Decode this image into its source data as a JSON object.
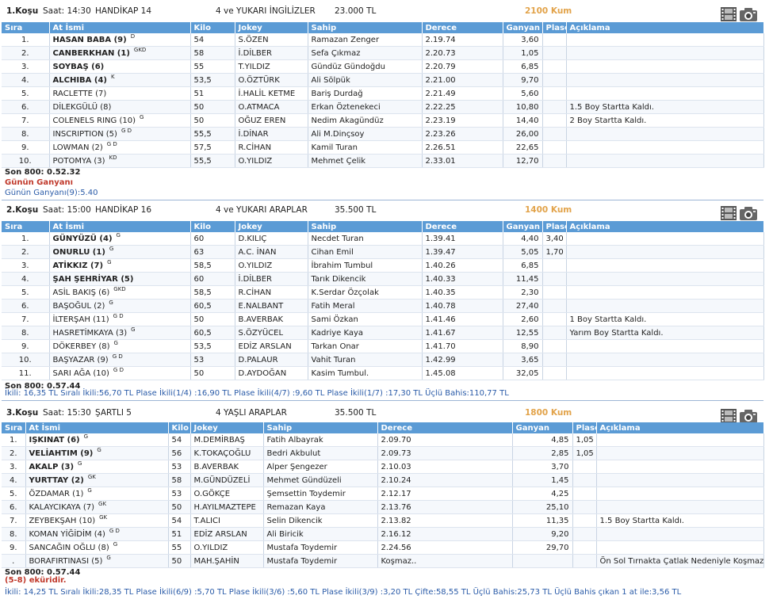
{
  "labels": {
    "son800_label": "Son 800:",
    "cols1": [
      "Sıra",
      "At İsmi",
      "Kilo",
      "Jokey",
      "Sahip",
      "Derece",
      "Ganyan",
      "Plase",
      "Açıklama"
    ],
    "cols3": [
      "Sıra",
      "At İsmi",
      "Kilo",
      "Jokey",
      "Sahip",
      "Derece",
      "Ganyan",
      "Plase",
      "Açıklama"
    ]
  },
  "races": [
    {
      "title": "1.Koşu",
      "time": "Saat: 14:30",
      "type": "HANDİKAP  14",
      "group": "4 ve YUKARI İNGİLİZLER",
      "prize": "23.000 TL",
      "distance": "2100 Kum",
      "son800": "Son 800: 0.52.32",
      "red_note": "Günün Ganyanı",
      "info": "Günün Ganyanı(9):5.40",
      "rows": [
        {
          "no": "1.",
          "name": "HASAN BABA (9)",
          "sup": "D",
          "bold": true,
          "kilo": "54",
          "jokey": "S.ÖZEN",
          "sahip": "Ramazan Zenger",
          "derece": "2.19.74",
          "ganyan": "3,60",
          "plase": "",
          "aciklama": ""
        },
        {
          "no": "2.",
          "name": "CANBERKHAN (1)",
          "sup": "GKD",
          "bold": true,
          "kilo": "58",
          "jokey": "İ.DİLBER",
          "sahip": "Sefa Çıkmaz",
          "derece": "2.20.73",
          "ganyan": "1,05",
          "plase": "",
          "aciklama": ""
        },
        {
          "no": "3.",
          "name": "SOYBAŞ (6)",
          "sup": "",
          "bold": true,
          "kilo": "55",
          "jokey": "T.YILDIZ",
          "sahip": "Gündüz Gündoğdu",
          "derece": "2.20.79",
          "ganyan": "6,85",
          "plase": "",
          "aciklama": ""
        },
        {
          "no": "4.",
          "name": "ALCHIBA (4)",
          "sup": "K",
          "bold": true,
          "kilo": "53,5",
          "jokey": "O.ÖZTÜRK",
          "sahip": "Ali Sölpük",
          "derece": "2.21.00",
          "ganyan": "9,70",
          "plase": "",
          "aciklama": ""
        },
        {
          "no": "5.",
          "name": "RACLETTE (7)",
          "sup": "",
          "bold": false,
          "kilo": "51",
          "jokey": "İ.HALİL KETME",
          "sahip": "Bariş Durdağ",
          "derece": "2.21.49",
          "ganyan": "5,60",
          "plase": "",
          "aciklama": ""
        },
        {
          "no": "6.",
          "name": "DİLEKGÜLÜ (8)",
          "sup": "",
          "bold": false,
          "kilo": "50",
          "jokey": "O.ATMACA",
          "sahip": "Erkan Öztenekeci",
          "derece": "2.22.25",
          "ganyan": "10,80",
          "plase": "",
          "aciklama": "1.5 Boy Startta Kaldı."
        },
        {
          "no": "7.",
          "name": "COLENELS RING (10)",
          "sup": "G",
          "bold": false,
          "kilo": "50",
          "jokey": "OĞUZ EREN",
          "sahip": "Nedim Akagündüz",
          "derece": "2.23.19",
          "ganyan": "14,40",
          "plase": "",
          "aciklama": "2 Boy Startta Kaldı."
        },
        {
          "no": "8.",
          "name": "INSCRIPTION (5)",
          "sup": "G D",
          "bold": false,
          "kilo": "55,5",
          "jokey": "İ.DİNAR",
          "sahip": "Ali M.Dinçsoy",
          "derece": "2.23.26",
          "ganyan": "26,00",
          "plase": "",
          "aciklama": ""
        },
        {
          "no": "9.",
          "name": "LOWMAN (2)",
          "sup": "G D",
          "bold": false,
          "kilo": "57,5",
          "jokey": "R.CİHAN",
          "sahip": "Kamil Turan",
          "derece": "2.26.51",
          "ganyan": "22,65",
          "plase": "",
          "aciklama": ""
        },
        {
          "no": "10.",
          "name": "POTOMYA (3)",
          "sup": "KD",
          "bold": false,
          "kilo": "55,5",
          "jokey": "O.YILDIZ",
          "sahip": "Mehmet Çelik",
          "derece": "2.33.01",
          "ganyan": "12,70",
          "plase": "",
          "aciklama": ""
        }
      ]
    },
    {
      "title": "2.Koşu",
      "time": "Saat: 15:00",
      "type": "HANDİKAP  16",
      "group": "4 ve YUKARI ARAPLAR",
      "prize": "35.500 TL",
      "distance": "1400 Kum",
      "son800": "Son 800: 0.57.44",
      "red_note": "",
      "info": "İkili: 16,35 TL Sıralı İkili:56,70 TL Plase İkili(1/4) :16,90 TL Plase İkili(4/7) :9,60 TL Plase İkili(1/7) :17,30 TL Üçlü Bahis:110,77 TL",
      "rows": [
        {
          "no": "1.",
          "name": "GÜNYÜZÜ (4)",
          "sup": "G",
          "bold": true,
          "kilo": "60",
          "jokey": "D.KILIÇ",
          "sahip": "Necdet Turan",
          "derece": "1.39.41",
          "ganyan": "4,40",
          "plase": "3,40",
          "aciklama": ""
        },
        {
          "no": "2.",
          "name": "ONURLU (1)",
          "sup": "G",
          "bold": true,
          "kilo": "63",
          "jokey": "A.C. İNAN",
          "sahip": "Cihan Emil",
          "derece": "1.39.47",
          "ganyan": "5,05",
          "plase": "1,70",
          "aciklama": ""
        },
        {
          "no": "3.",
          "name": "ATİKKIZ (7)",
          "sup": "G",
          "bold": true,
          "kilo": "58,5",
          "jokey": "O.YILDIZ",
          "sahip": "İbrahim Tumbul",
          "derece": "1.40.26",
          "ganyan": "6,85",
          "plase": "",
          "aciklama": ""
        },
        {
          "no": "4.",
          "name": "ŞAH ŞEHRİYAR (5)",
          "sup": "",
          "bold": true,
          "kilo": "60",
          "jokey": "İ.DİLBER",
          "sahip": "Tarık Dikencik",
          "derece": "1.40.33",
          "ganyan": "11,45",
          "plase": "",
          "aciklama": ""
        },
        {
          "no": "5.",
          "name": "ASİL BAKIŞ (6)",
          "sup": "GKD",
          "bold": false,
          "kilo": "58,5",
          "jokey": "R.CİHAN",
          "sahip": "K.Serdar Özçolak",
          "derece": "1.40.35",
          "ganyan": "2,30",
          "plase": "",
          "aciklama": ""
        },
        {
          "no": "6.",
          "name": "BAŞOĞUL (2)",
          "sup": "G",
          "bold": false,
          "kilo": "60,5",
          "jokey": "E.NALBANT",
          "sahip": "Fatih Meral",
          "derece": "1.40.78",
          "ganyan": "27,40",
          "plase": "",
          "aciklama": ""
        },
        {
          "no": "7.",
          "name": "İLTERŞAH (11)",
          "sup": "G D",
          "bold": false,
          "kilo": "50",
          "jokey": "B.AVERBAK",
          "sahip": "Sami Özkan",
          "derece": "1.41.46",
          "ganyan": "2,60",
          "plase": "",
          "aciklama": "1 Boy Startta Kaldı."
        },
        {
          "no": "8.",
          "name": "HASRETİMKAYA (3)",
          "sup": "G",
          "bold": false,
          "kilo": "60,5",
          "jokey": "S.ÖZYÜCEL",
          "sahip": "Kadriye Kaya",
          "derece": "1.41.67",
          "ganyan": "12,55",
          "plase": "",
          "aciklama": "Yarım Boy Startta Kaldı."
        },
        {
          "no": "9.",
          "name": "DÖKERBEY (8)",
          "sup": "G",
          "bold": false,
          "kilo": "53,5",
          "jokey": "EDİZ ARSLAN",
          "sahip": "Tarkan Onar",
          "derece": "1.41.70",
          "ganyan": "8,90",
          "plase": "",
          "aciklama": ""
        },
        {
          "no": "10.",
          "name": "BAŞYAZAR (9)",
          "sup": "G D",
          "bold": false,
          "kilo": "53",
          "jokey": "D.PALAUR",
          "sahip": "Vahit Turan",
          "derece": "1.42.99",
          "ganyan": "3,65",
          "plase": "",
          "aciklama": ""
        },
        {
          "no": "11.",
          "name": "SARI AĞA (10)",
          "sup": "G D",
          "bold": false,
          "kilo": "50",
          "jokey": "D.AYDOĞAN",
          "sahip": "Kasim Tumbul.",
          "derece": "1.45.08",
          "ganyan": "32,05",
          "plase": "",
          "aciklama": ""
        }
      ]
    },
    {
      "title": "3.Koşu",
      "time": "Saat: 15:30",
      "type": "ŞARTLI  5",
      "group": "4 YAŞLI ARAPLAR",
      "prize": "35.500 TL",
      "distance": "1800 Kum",
      "son800": "Son 800: 0.57.44",
      "red_note": "(5-8) eküridir.",
      "info": "İkili: 14,25 TL Sıralı İkili:28,35 TL Plase İkili(6/9) :5,70 TL Plase İkili(3/6) :5,60 TL Plase İkili(3/9) :3,20 TL Çifte:58,55 TL Üçlü Bahis:25,73 TL Üçlü Bahis çıkan 1 at ile:3,56 TL",
      "rows": [
        {
          "no": "1.",
          "name": "IŞKINAT (6)",
          "sup": "G",
          "bold": true,
          "kilo": "54",
          "jokey": "M.DEMİRBAŞ",
          "sahip": "Fatih Albayrak",
          "derece": "2.09.70",
          "ganyan": "4,85",
          "plase": "1,05",
          "aciklama": ""
        },
        {
          "no": "2.",
          "name": "VELİAHTIM (9)",
          "sup": "G",
          "bold": true,
          "kilo": "56",
          "jokey": "K.TOKAÇOĞLU",
          "sahip": "Bedri Akbulut",
          "derece": "2.09.73",
          "ganyan": "2,85",
          "plase": "1,05",
          "aciklama": ""
        },
        {
          "no": "3.",
          "name": "AKALP (3)",
          "sup": "G",
          "bold": true,
          "kilo": "53",
          "jokey": "B.AVERBAK",
          "sahip": "Alper Şengezer",
          "derece": "2.10.03",
          "ganyan": "3,70",
          "plase": "",
          "aciklama": ""
        },
        {
          "no": "4.",
          "name": "YURTTAY (2)",
          "sup": "GK",
          "bold": true,
          "kilo": "58",
          "jokey": "M.GÜNDÜZELİ",
          "sahip": "Mehmet Gündüzeli",
          "derece": "2.10.24",
          "ganyan": "1,45",
          "plase": "",
          "aciklama": ""
        },
        {
          "no": "5.",
          "name": "ÖZDAMAR (1)",
          "sup": "G",
          "bold": false,
          "kilo": "53",
          "jokey": "O.GÖKÇE",
          "sahip": "Şemsettin Toydemir",
          "derece": "2.12.17",
          "ganyan": "4,25",
          "plase": "",
          "aciklama": ""
        },
        {
          "no": "6.",
          "name": "KALAYCIKAYA (7)",
          "sup": "GK",
          "bold": false,
          "kilo": "50",
          "jokey": "H.AYILMAZTEPE",
          "sahip": "Remazan Kaya",
          "derece": "2.13.76",
          "ganyan": "25,10",
          "plase": "",
          "aciklama": ""
        },
        {
          "no": "7.",
          "name": "ZEYBEKŞAH (10)",
          "sup": "GK",
          "bold": false,
          "kilo": "54",
          "jokey": "T.ALICI",
          "sahip": "Selin Dikencik",
          "derece": "2.13.82",
          "ganyan": "11,35",
          "plase": "",
          "aciklama": "1.5 Boy Startta Kaldı."
        },
        {
          "no": "8.",
          "name": "KOMAN YİĞİDİM (4)",
          "sup": "G D",
          "bold": false,
          "kilo": "51",
          "jokey": "EDİZ ARSLAN",
          "sahip": "Ali Biricik",
          "derece": "2.16.12",
          "ganyan": "9,20",
          "plase": "",
          "aciklama": ""
        },
        {
          "no": "9.",
          "name": "SANCAĞIN OĞLU (8)",
          "sup": "G",
          "bold": false,
          "kilo": "55",
          "jokey": "O.YILDIZ",
          "sahip": "Mustafa Toydemir",
          "derece": "2.24.56",
          "ganyan": "29,70",
          "plase": "",
          "aciklama": ""
        },
        {
          "no": ".",
          "name": "BORAFIRTINASI (5)",
          "sup": "G",
          "bold": false,
          "kilo": "50",
          "jokey": "MAH.ŞAHİN",
          "sahip": "Mustafa Toydemir",
          "derece": "Koşmaz..",
          "ganyan": "",
          "plase": "",
          "aciklama": "Ön Sol Tırnakta Çatlak Nedeniyle Koşmaz."
        }
      ]
    }
  ],
  "icons": {
    "film": "film-icon",
    "camera": "camera-icon"
  },
  "colors": {
    "header_bg": "#5b9bd5",
    "distance": "#e2a34a",
    "red": "#c0392b",
    "info": "#2a5ba8"
  }
}
